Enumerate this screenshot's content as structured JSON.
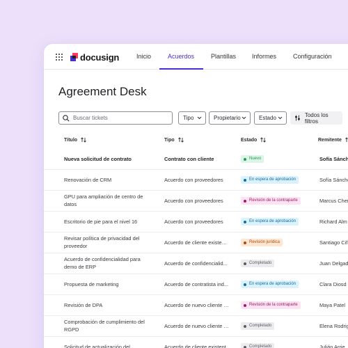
{
  "app": {
    "logo_text": "docusign",
    "nav": [
      "Inicio",
      "Acuerdos",
      "Plantillas",
      "Informes",
      "Configuración"
    ],
    "active_nav": "Acuerdos"
  },
  "page": {
    "title": "Agreement Desk"
  },
  "toolbar": {
    "search_placeholder": "Buscar tickets",
    "filters": [
      "Tipo",
      "Propietario",
      "Estado"
    ],
    "all_filters_label": "Todos los filtros"
  },
  "table": {
    "headers": [
      "Título",
      "Tipo",
      "Estado",
      "Remitente"
    ],
    "rows": [
      {
        "title": "Nueva solicitud de contrato",
        "type": "Contrato con cliente",
        "status": "Nuevo",
        "status_color": "#1f9d55",
        "sender": "Sofía Sánchez",
        "bold": true
      },
      {
        "title": "Renovación de CRM",
        "type": "Acuerdo con proveedores",
        "status": "En espera de aprobación",
        "status_color": "#0c6fa8",
        "sender": "Sofía Sánchez"
      },
      {
        "title": "GPU para ampliación de centro de datos",
        "type": "Acuerdo con proveedores",
        "status": "Revisión de la contraparte",
        "status_color": "#a4166b",
        "sender": "Marcus Chen"
      },
      {
        "title": "Escritorio de pie para el nivel 16",
        "type": "Acuerdo con proveedores",
        "status": "En espera de aprobación",
        "status_color": "#0c6fa8",
        "sender": "Richard Alm"
      },
      {
        "title": "Revisar política de privacidad del proveedor",
        "type": "Acuerdo de cliente existent...",
        "status": "Revisión jurídica",
        "status_color": "#b54708",
        "sender": "Santiago Cif"
      },
      {
        "title": "Acuerdo de confidencialidad para demo de ERP",
        "type": "Acuerdo de confidencialid...",
        "status": "Completado",
        "status_color": "#5b5b63",
        "sender": "Juan Delgad"
      },
      {
        "title": "Propuesta de marketing",
        "type": "Acuerdo de contratista ind...",
        "status": "En espera de aprobación",
        "status_color": "#0c6fa8",
        "sender": "Clara Diosd"
      },
      {
        "title": "Revisión de DPA",
        "type": "Acuerdo de nuevo cliente (...",
        "status": "Revisión de la contraparte",
        "status_color": "#a4166b",
        "sender": "Maya Patel"
      },
      {
        "title": "Comprobación de cumplimiento del RGPD",
        "type": "Acuerdo de nuevo cliente (...",
        "status": "Completado",
        "status_color": "#5b5b63",
        "sender": "Elena Rodrig"
      },
      {
        "title": "Solicitud de actualización del",
        "type": "Acuerdo de cliente existent",
        "status": "Completado",
        "status_color": "#5b5b63",
        "sender": "Julián Arrie"
      }
    ]
  },
  "colors": {
    "background": "#ece0fb",
    "accent": "#4b2bd6",
    "badge_green_bg": "#dcf5e6",
    "badge_blue_bg": "#dbf1fb",
    "badge_pink_bg": "#fbe3f1",
    "badge_orange_bg": "#fde7d3",
    "badge_gray_bg": "#ececef"
  },
  "icons": [
    "apps-grid-icon",
    "docusign-logo-icon",
    "search-icon",
    "chevron-down-icon",
    "filter-sliders-icon",
    "sort-arrows-icon"
  ]
}
